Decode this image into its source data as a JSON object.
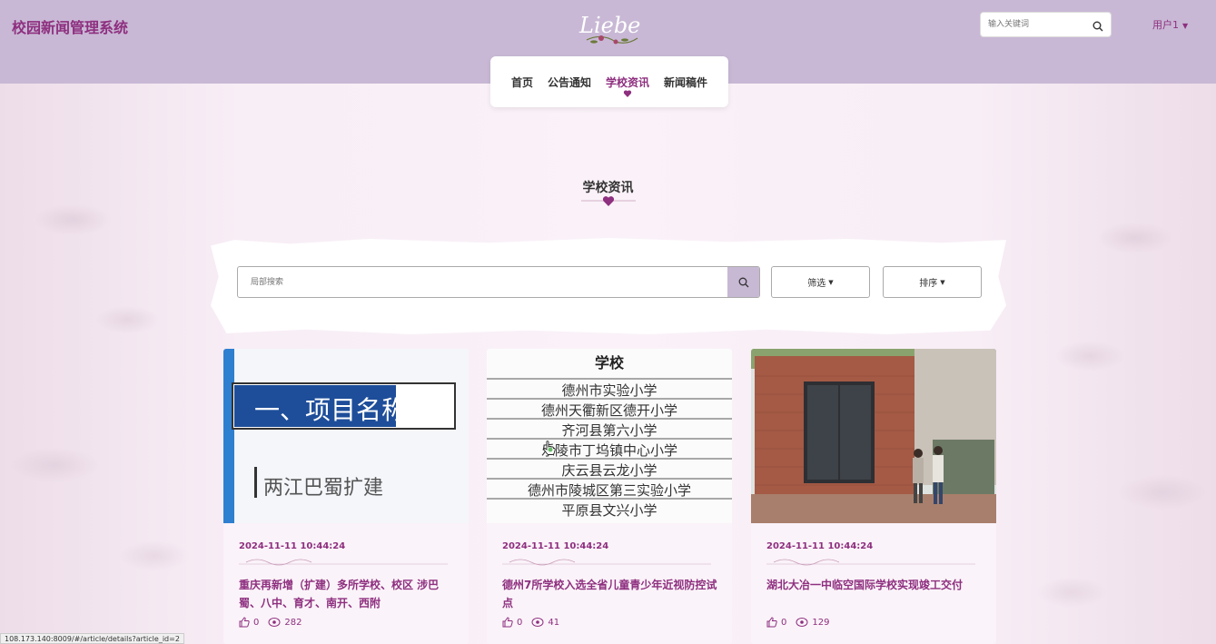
{
  "header": {
    "brand": "校园新闻管理系统",
    "logo_text": "Liebe",
    "search_placeholder": "输入关键词",
    "user_label": "用户1"
  },
  "nav": {
    "items": [
      {
        "label": "首页",
        "active": false
      },
      {
        "label": "公告通知",
        "active": false
      },
      {
        "label": "学校资讯",
        "active": true
      },
      {
        "label": "新闻稿件",
        "active": false
      }
    ]
  },
  "section": {
    "title": "学校资讯"
  },
  "filters": {
    "search_placeholder": "局部搜索",
    "filter_label": "筛选",
    "sort_label": "排序"
  },
  "cards": [
    {
      "date": "2024-11-11 10:44:24",
      "title": "重庆再新增（扩建）多所学校、校区 涉巴蜀、八中、育才、南开、西附",
      "likes": "0",
      "views": "282",
      "thumb_heading": "一、项目名称",
      "thumb_sub": "两江巴蜀扩建"
    },
    {
      "date": "2024-11-11 10:44:24",
      "title": "德州7所学校入选全省儿童青少年近视防控试点",
      "likes": "0",
      "views": "41",
      "thumb_heading": "学校",
      "thumb_rows": [
        "德州市实验小学",
        "德州天衢新区德开小学",
        "齐河县第六小学",
        "乐陵市丁坞镇中心小学",
        "庆云县云龙小学",
        "德州市陵城区第三实验小学",
        "平原县文兴小学"
      ]
    },
    {
      "date": "2024-11-11 10:44:24",
      "title": "湖北大冶一中临空国际学校实现竣工交付",
      "likes": "0",
      "views": "129"
    }
  ],
  "status_url": "108.173.140:8009/#/article/details?article_id=2",
  "colors": {
    "header_bg": "#c8b8d5",
    "accent": "#8e2f7f",
    "page_bg": "#f6eaf3"
  }
}
